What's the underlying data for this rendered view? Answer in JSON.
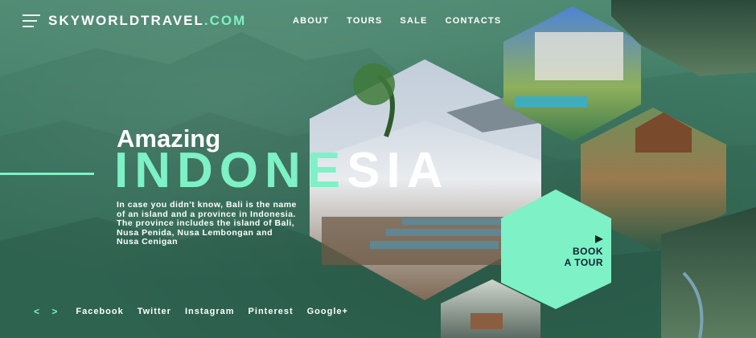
{
  "header": {
    "logo_main": "SKYWORLDTRAVEL",
    "logo_suffix": ".COM",
    "nav": [
      "ABOUT",
      "TOURS",
      "SALE",
      "CONTACTS"
    ]
  },
  "hero": {
    "title_line1": "Amazing",
    "title_part1": "INDONE",
    "title_part2": "SIA",
    "description": "In case you didn't know, Bali is the name of an island and a province in Indonesia. The province includes the island of Bali, Nusa Penida, Nusa Lembongan and Nusa Cenigan"
  },
  "cta": {
    "icon": "play-icon",
    "label_line1": "BOOK",
    "label_line2": "A TOUR"
  },
  "social": {
    "arrows": "< >",
    "links": [
      "Facebook",
      "Twitter",
      "Instagram",
      "Pinterest",
      "Google+"
    ]
  },
  "colors": {
    "accent": "#7ef1c6",
    "background": "#3f7b64",
    "text": "#ffffff"
  }
}
